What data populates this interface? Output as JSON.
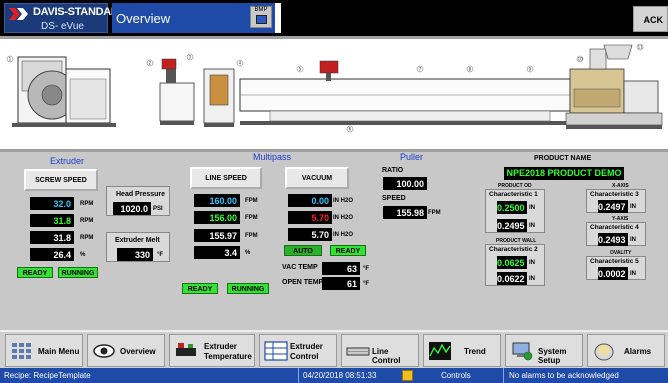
{
  "header": {
    "brand": "DAVIS-STANDARD",
    "product": "DS- eVue",
    "title": "Overview",
    "bmp_label": "BMP",
    "ack_label": "ACK"
  },
  "machine": {
    "callouts": [
      "1",
      "2",
      "3",
      "4",
      "5",
      "6",
      "7",
      "8",
      "9",
      "10",
      "11"
    ]
  },
  "extruder": {
    "title": "Extruder",
    "screw_speed_label": "SCREW SPEED",
    "rows": [
      {
        "value": "32.0",
        "unit": "RPM",
        "color": "cyan"
      },
      {
        "value": "31.8",
        "unit": "RPM",
        "color": "green"
      },
      {
        "value": "31.8",
        "unit": "RPM",
        "color": "white"
      },
      {
        "value": "26.4",
        "unit": "%",
        "color": "white"
      }
    ],
    "status_ready": "READY",
    "status_running": "RUNNING",
    "head_pressure_label": "Head Pressure",
    "head_pressure_value": "1020.0",
    "head_pressure_unit": "PSI",
    "melt_label": "Extruder Melt",
    "melt_value": "330",
    "melt_unit": "°F"
  },
  "multipass": {
    "title": "Multipass",
    "line_speed_label": "LINE SPEED",
    "rows": [
      {
        "value": "160.00",
        "unit": "FPM",
        "color": "cyan"
      },
      {
        "value": "156.00",
        "unit": "FPM",
        "color": "green"
      },
      {
        "value": "155.97",
        "unit": "FPM",
        "color": "white"
      },
      {
        "value": "3.4",
        "unit": "%",
        "color": "white"
      }
    ],
    "status_ready": "READY",
    "status_running": "RUNNING",
    "vacuum_label": "VACUUM",
    "vac_rows": [
      {
        "value": "0.00",
        "unit": "IN H2O",
        "color": "cyan"
      },
      {
        "value": "5.70",
        "unit": "IN H2O",
        "color": "red"
      },
      {
        "value": "5.70",
        "unit": "IN H2O",
        "color": "white"
      }
    ],
    "auto_label": "AUTO",
    "vac_ready_label": "READY",
    "vac_temp_label": "VAC TEMP",
    "vac_temp_value": "63",
    "vac_temp_unit": "°F",
    "open_temp_label": "OPEN TEMP",
    "open_temp_value": "61",
    "open_temp_unit": "°F"
  },
  "puller": {
    "title": "Puller",
    "ratio_label": "RATIO",
    "ratio_value": "100.00",
    "speed_label": "SPEED",
    "speed_value": "155.98",
    "speed_unit": "FPM"
  },
  "product": {
    "title": "PRODUCT NAME",
    "name": "NPE2018 PRODUCT DEMO",
    "od_label": "PRODUCT OD",
    "char1_label": "Characteristic 1",
    "char1_top": "0.2500",
    "char1_bottom": "0.2495",
    "wall_label": "PRODUCT WALL",
    "char2_label": "Characteristic 2",
    "char2_top": "0.0625",
    "char2_bottom": "0.0622",
    "xaxis_label": "X-AXIS",
    "char3_label": "Characteristic 3",
    "char3_value": "0.2497",
    "yaxis_label": "Y-AXIS",
    "char4_label": "Characteristic 4",
    "char4_value": "0.2493",
    "ovality_label": "OVALITY",
    "char5_label": "Characteristic 5",
    "char5_value": "0.0002",
    "unit": "IN"
  },
  "nav": {
    "main_menu": "Main Menu",
    "overview": "Overview",
    "extruder_temp_1": "Extruder",
    "extruder_temp_2": "Temperature",
    "extruder_control_1": "Extruder",
    "extruder_control_2": "Control",
    "line_control": "Line Control",
    "trend": "Trend",
    "system_setup": "System Setup",
    "alarms": "Alarms"
  },
  "statusbar": {
    "recipe": "Recipe: RecipeTemplate",
    "datetime": "04/20/2018 08:51:33",
    "controls": "Controls",
    "alarm_msg": "No alarms to be acknowledged"
  },
  "colors": {
    "accent_blue": "#1e4aa8",
    "ready_green": "#34e234",
    "value_cyan": "#30c8ff",
    "value_green": "#32ff32",
    "value_red": "#ff2020"
  }
}
